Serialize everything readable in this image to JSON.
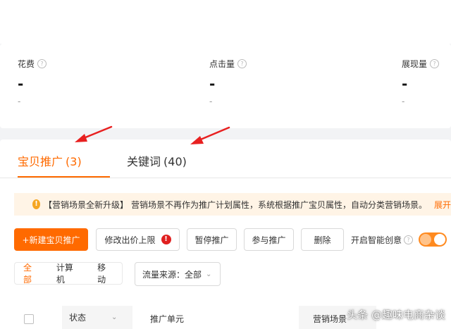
{
  "stats": [
    {
      "label": "花费",
      "value": "-",
      "compare": "-"
    },
    {
      "label": "点击量",
      "value": "-",
      "compare": "-"
    },
    {
      "label": "展现量",
      "value": "-",
      "compare": "-"
    }
  ],
  "tabs": [
    {
      "label": "宝贝推广",
      "count": "(3)"
    },
    {
      "label": "关键词",
      "count": "(40)"
    }
  ],
  "notice": {
    "title": "【营销场景全新升级】",
    "text": "营销场景不再作为推广计划属性，系统根据推广宝贝属性，自动分类营销场景。",
    "link": "展开"
  },
  "toolbar": {
    "new_item": "+新建宝贝推广",
    "bid_limit": "修改出价上限",
    "pause": "暂停推广",
    "join": "参与推广",
    "delete": "删除",
    "smart_creative": "开启智能创意"
  },
  "filters": {
    "devices": [
      "全部",
      "计算机",
      "移动"
    ],
    "traffic_source": "流量来源：全部"
  },
  "table": {
    "status": "状态",
    "unit": "推广单元",
    "scene": "营销场景"
  },
  "watermark": "头条 @趣味电商杂谈",
  "colors": {
    "accent": "#ff6a00",
    "notice_bg": "#fff4e6",
    "arrow": "#e82020"
  }
}
